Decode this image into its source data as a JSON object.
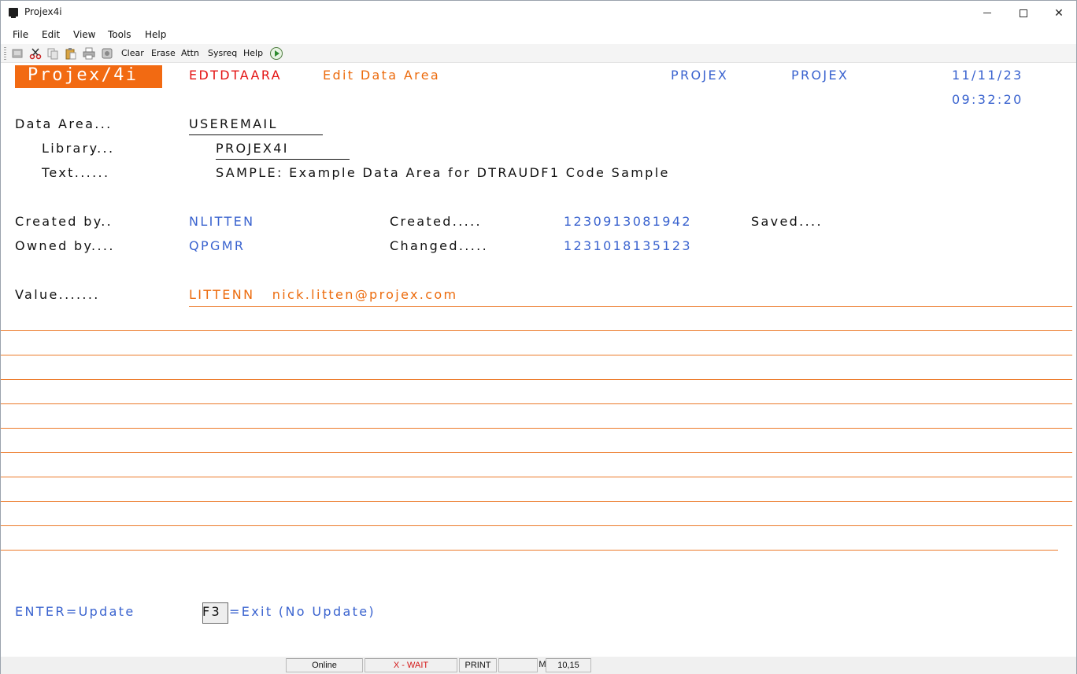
{
  "window": {
    "title": "Projex4i"
  },
  "menu": {
    "file": "File",
    "edit": "Edit",
    "view": "View",
    "tools": "Tools",
    "help": "Help"
  },
  "toolbar": {
    "clear": "Clear",
    "erase": "Erase",
    "attn": "Attn",
    "sysreq": "Sysreq",
    "help": "Help"
  },
  "screen": {
    "logo": "Projex/4i",
    "program": "EDTDTAARA",
    "screen_title": "Edit Data Area",
    "system": "PROJEX",
    "user": "PROJEX",
    "date": "11/11/23",
    "time": "09:32:20",
    "data_area_label": "Data Area...",
    "data_area_value": "USEREMAIL",
    "library_label": "Library...",
    "library_value": "PROJEX4I",
    "text_label": "Text......",
    "text_value": "SAMPLE: Example Data Area for DTRAUDF1 Code Sample",
    "created_by_label": "Created by..",
    "created_by_value": "NLITTEN",
    "created_label": "Created.....",
    "created_value": "1230913081942",
    "saved_label": "Saved....",
    "owned_by_label": "Owned by....",
    "owned_by_value": "QPGMR",
    "changed_label": "Changed.....",
    "changed_value": "1231018135123",
    "value_label": "Value.......",
    "value_line1": "LITTENN   nick.litten@projex.com",
    "fkey_enter": "ENTER=Update",
    "fkey_f3_key": "F3",
    "fkey_f3_text": "=Exit (No Update)"
  },
  "status": {
    "online": "Online",
    "wait": "X - WAIT",
    "print": "PRINT",
    "mode": "M",
    "cursor_pos": "10,15"
  },
  "colors": {
    "accent_orange": "#ec6b0d",
    "logo_bg": "#f26a12",
    "field_blue": "#3a63cf",
    "program_red": "#e41515"
  }
}
